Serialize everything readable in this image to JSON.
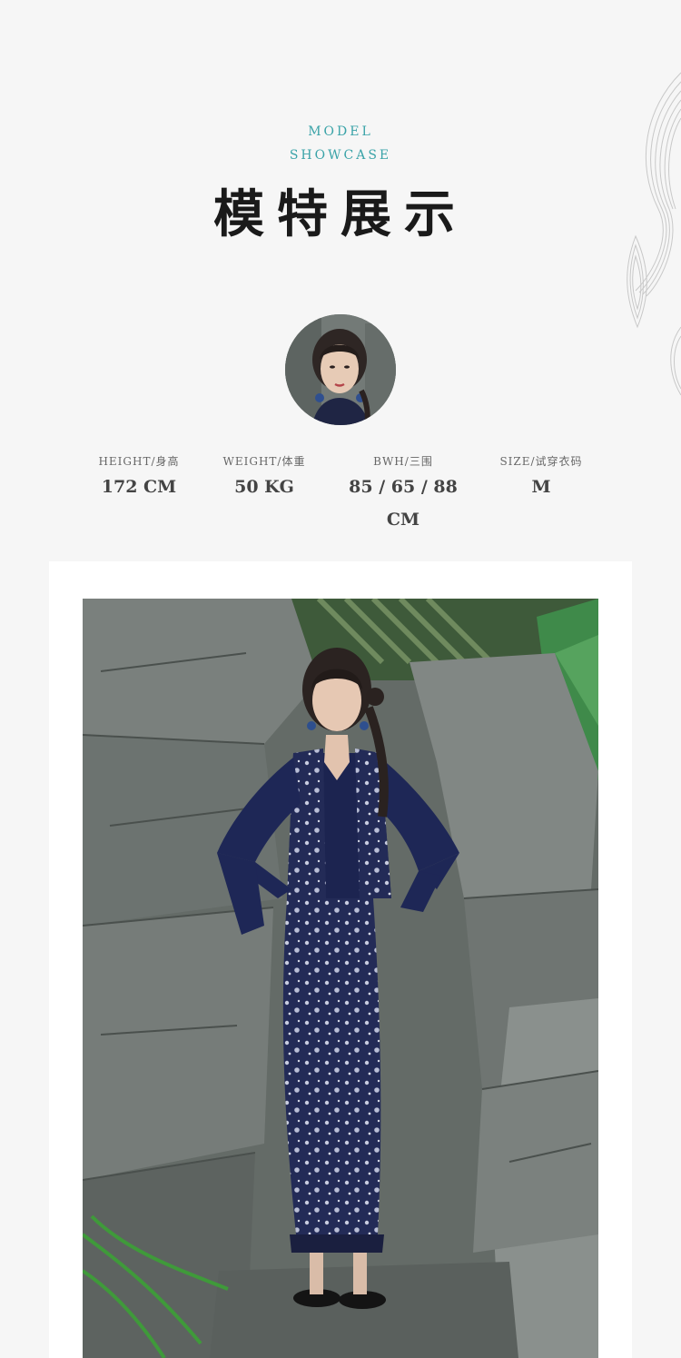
{
  "header": {
    "subtitle_line1": "MODEL",
    "subtitle_line2": "SHOWCASE",
    "title": "模特展示"
  },
  "model_stats": [
    {
      "label": "HEIGHT/身高",
      "value": "172 CM"
    },
    {
      "label": "WEIGHT/体重",
      "value": "50 KG"
    },
    {
      "label": "BWH/三围",
      "value": "85 / 65 / 88 CM"
    },
    {
      "label": "SIZE/试穿衣码",
      "value": "M"
    }
  ],
  "colors": {
    "accent_teal": "#3aa3a8",
    "title": "#1a1a1a",
    "background": "#f6f6f6",
    "dress_navy": "#1c2450"
  }
}
